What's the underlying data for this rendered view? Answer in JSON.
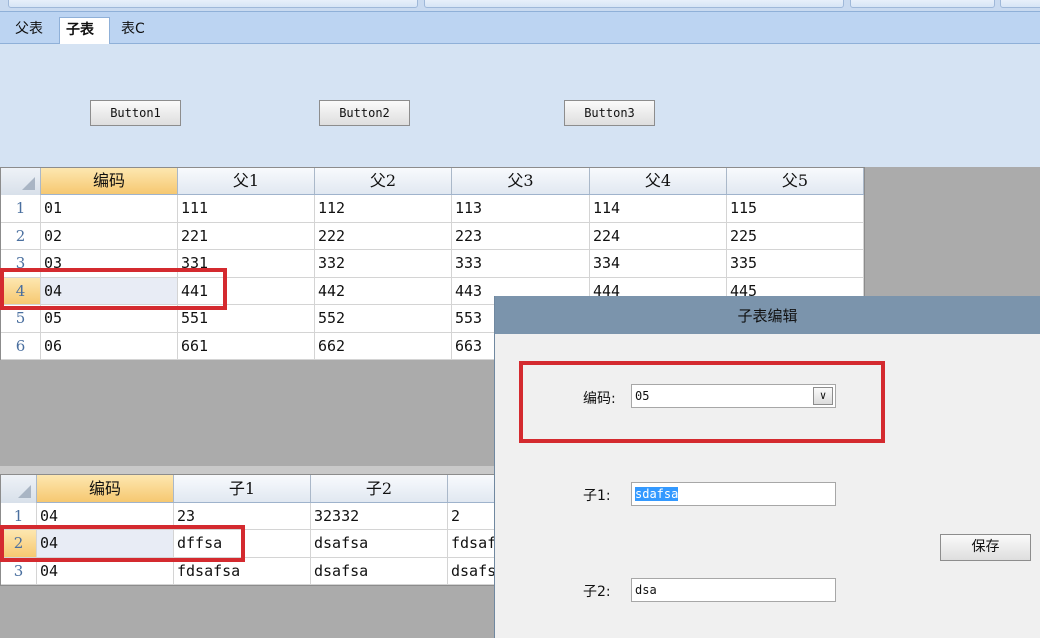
{
  "tabs": [
    {
      "label": "父表"
    },
    {
      "label": "子表",
      "active": true
    },
    {
      "label": "表C"
    }
  ],
  "buttons": [
    "Button1",
    "Button2",
    "Button3"
  ],
  "parent_grid": {
    "columns": [
      "编码",
      "父1",
      "父2",
      "父3",
      "父4",
      "父5"
    ],
    "row_numbers": [
      "1",
      "2",
      "3",
      "4",
      "5",
      "6"
    ],
    "selected_row": "4",
    "rows": [
      [
        "01",
        "111",
        "112",
        "113",
        "114",
        "115"
      ],
      [
        "02",
        "221",
        "222",
        "223",
        "224",
        "225"
      ],
      [
        "03",
        "331",
        "332",
        "333",
        "334",
        "335"
      ],
      [
        "04",
        "441",
        "442",
        "443",
        "444",
        "445"
      ],
      [
        "05",
        "551",
        "552",
        "553"
      ],
      [
        "06",
        "661",
        "662",
        "663"
      ]
    ]
  },
  "child_grid": {
    "columns": [
      "编码",
      "子1",
      "子2",
      ""
    ],
    "row_numbers": [
      "1",
      "2",
      "3"
    ],
    "selected_row": "2",
    "rows": [
      [
        "04",
        "23",
        "32332",
        "2"
      ],
      [
        "04",
        "dffsa",
        "dsafsa",
        "fdsaf"
      ],
      [
        "04",
        "fdsafsa",
        "dsafsa",
        "dsafs"
      ]
    ]
  },
  "dialog": {
    "title": "子表编辑",
    "code_label": "编码:",
    "code_value": "05",
    "sub1_label": "子1:",
    "sub1_value": "sdafsa",
    "sub2_label": "子2:",
    "sub2_value": "dsa",
    "save_label": "保存"
  },
  "colors": {
    "annotation_red": "#d42a2f",
    "header_selected": "#f6c871",
    "tab_strip": "#bcd4f2",
    "dialog_title": "#7b94ac"
  }
}
